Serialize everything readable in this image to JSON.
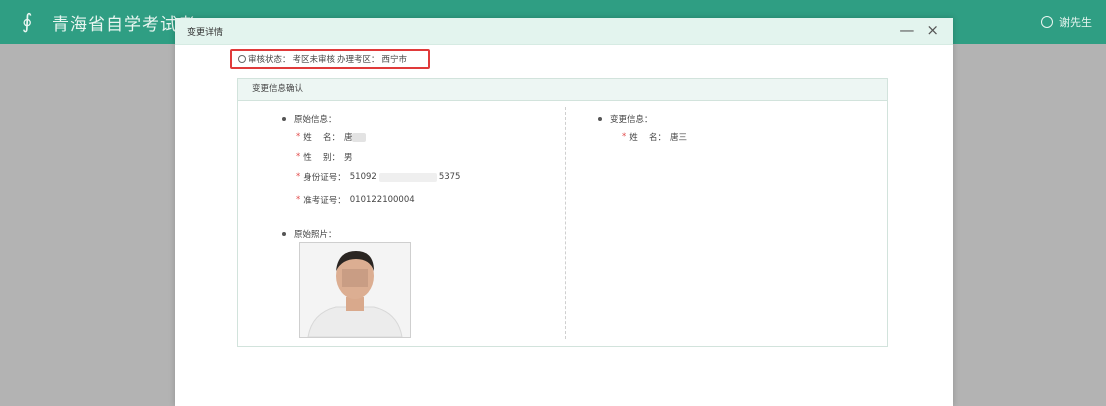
{
  "app": {
    "title": "青海省自学考试考",
    "user": "谢先生"
  },
  "modal": {
    "title": "变更详情",
    "minimize": "—",
    "close": "×",
    "status": {
      "label": "审核状态：",
      "value": "考区未审核",
      "district_label": "办理考区：",
      "district_value": "西宁市"
    },
    "panel": {
      "title": "变更信息确认",
      "original": {
        "section_title": "原始信息：",
        "name_label": "姓　 名：",
        "name_value": "唐",
        "gender_label": "性　 别：",
        "gender_value": "男",
        "id_label": "身份证号：",
        "id_prefix": "51092",
        "id_suffix": "5375",
        "exam_label": "准考证号：",
        "exam_value": "010122100004",
        "photo_title": "原始照片："
      },
      "changed": {
        "section_title": "变更信息：",
        "name_label": "姓　 名：",
        "name_value": "唐三"
      }
    }
  },
  "colors": {
    "header": "#2f9e83",
    "modal_header": "#e3f4ee",
    "highlight_border": "#e03a3a",
    "required": "#e24b4b"
  }
}
